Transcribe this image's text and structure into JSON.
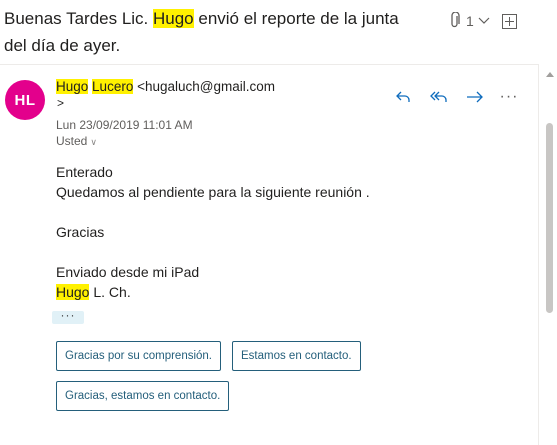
{
  "subject": {
    "prefix": "Buenas Tardes Lic. ",
    "highlight": "Hugo",
    "suffix": " envió el reporte de la junta del día de ayer.",
    "attachment_count": "1"
  },
  "message": {
    "avatar_initials": "HL",
    "avatar_color": "#e3008c",
    "sender_first": "Hugo",
    "sender_last": "Lucero",
    "sender_email": "<hugaluch@gmail.com",
    "sender_email_end": ">",
    "date": "Lun 23/09/2019 11:01 AM",
    "to": "Usted",
    "body": {
      "line1": "Enterado",
      "line2": "Quedamos al pendiente para la siguiente reunión .",
      "line3": "Gracias",
      "line4": "Enviado desde mi iPad",
      "sig_highlight": "Hugo",
      "sig_rest": " L. Ch."
    },
    "ellipsis": "···"
  },
  "quick_replies": [
    "Gracias por su comprensión.",
    "Estamos en contacto.",
    "Gracias, estamos en contacto."
  ],
  "colors": {
    "highlight": "#fff100",
    "accent": "#0f6cbd",
    "chip_border": "#245f7b"
  }
}
